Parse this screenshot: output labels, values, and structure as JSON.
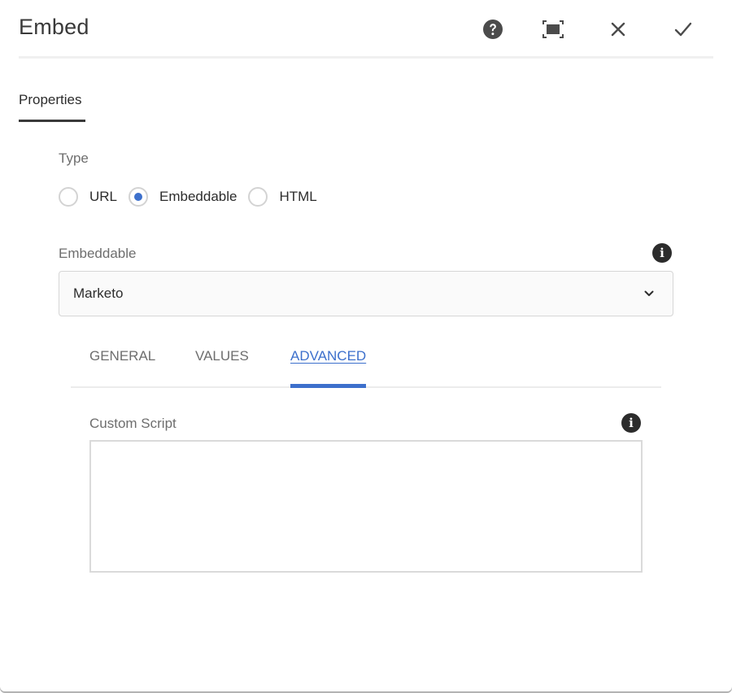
{
  "dialog": {
    "title": "Embed",
    "header_actions": [
      {
        "name": "help",
        "icon": "help-icon"
      },
      {
        "name": "fullscreen",
        "icon": "fullscreen-icon"
      },
      {
        "name": "cancel",
        "icon": "close-icon"
      },
      {
        "name": "done",
        "icon": "checkmark-icon"
      }
    ]
  },
  "tabs": [
    {
      "label": "Properties",
      "active": true
    }
  ],
  "type_field": {
    "label": "Type",
    "options": [
      {
        "label": "URL",
        "selected": false
      },
      {
        "label": "Embeddable",
        "selected": true
      },
      {
        "label": "HTML",
        "selected": false
      }
    ]
  },
  "embeddable_field": {
    "label": "Embeddable",
    "info_icon": "info-icon",
    "selected_value": "Marketo"
  },
  "subtabs": [
    {
      "label": "GENERAL",
      "active": false
    },
    {
      "label": "VALUES",
      "active": false
    },
    {
      "label": "ADVANCED",
      "active": true
    }
  ],
  "custom_script": {
    "label": "Custom Script",
    "info_icon": "info-icon",
    "value": ""
  },
  "colors": {
    "accent": "#3d70cc",
    "text": "#2c2c2c",
    "label": "#6e6e6e"
  }
}
